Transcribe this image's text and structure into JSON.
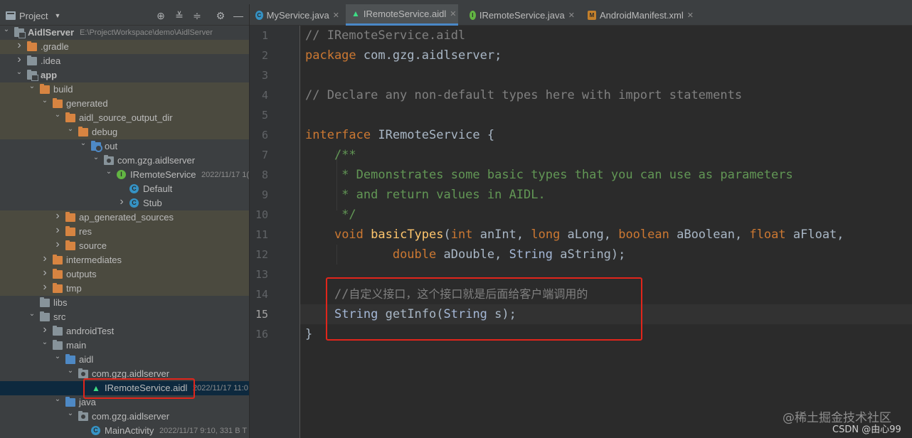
{
  "project_panel": {
    "title": "Project",
    "tree": [
      {
        "label": "AidlServer",
        "meta": "E:\\ProjectWorkspace\\demo\\AidlServer",
        "icon": "module-folder-icon",
        "arrow": "open",
        "bold": true
      },
      {
        "label": ".gradle",
        "icon": "folder-icon-orange",
        "arrow": "closed",
        "excluded": true
      },
      {
        "label": ".idea",
        "icon": "folder-icon-grey",
        "arrow": "closed"
      },
      {
        "label": "app",
        "icon": "module-folder-icon",
        "arrow": "open",
        "bold": true
      },
      {
        "label": "build",
        "icon": "folder-icon-orange",
        "arrow": "open",
        "excluded": true
      },
      {
        "label": "generated",
        "icon": "folder-icon-orange",
        "arrow": "open",
        "excluded": true
      },
      {
        "label": "aidl_source_output_dir",
        "icon": "folder-icon-orange",
        "arrow": "open",
        "excluded": true
      },
      {
        "label": "debug",
        "icon": "folder-icon-orange",
        "arrow": "open",
        "excluded": true
      },
      {
        "label": "out",
        "icon": "generated-source-folder-icon",
        "arrow": "open"
      },
      {
        "label": "com.gzg.aidlserver",
        "icon": "package-icon",
        "arrow": "open"
      },
      {
        "label": "IRemoteService",
        "meta": "2022/11/17 1(",
        "icon": "interface-icon",
        "arrow": "open"
      },
      {
        "label": "Default",
        "icon": "class-icon"
      },
      {
        "label": "Stub",
        "icon": "abstract-class-icon",
        "arrow": "closed"
      },
      {
        "label": "ap_generated_sources",
        "icon": "folder-icon-orange",
        "arrow": "closed",
        "excluded": true
      },
      {
        "label": "res",
        "icon": "folder-icon-orange",
        "arrow": "closed",
        "excluded": true
      },
      {
        "label": "source",
        "icon": "folder-icon-orange",
        "arrow": "closed",
        "excluded": true
      },
      {
        "label": "intermediates",
        "icon": "folder-icon-orange",
        "arrow": "closed",
        "excluded": true
      },
      {
        "label": "outputs",
        "icon": "folder-icon-orange",
        "arrow": "closed",
        "excluded": true
      },
      {
        "label": "tmp",
        "icon": "folder-icon-orange",
        "arrow": "closed",
        "excluded": true
      },
      {
        "label": "libs",
        "icon": "folder-icon-grey"
      },
      {
        "label": "src",
        "icon": "folder-icon-grey",
        "arrow": "open"
      },
      {
        "label": "androidTest",
        "icon": "folder-icon-grey",
        "arrow": "closed"
      },
      {
        "label": "main",
        "icon": "folder-icon-grey",
        "arrow": "open"
      },
      {
        "label": "aidl",
        "icon": "folder-icon-blue",
        "arrow": "open"
      },
      {
        "label": "com.gzg.aidlserver",
        "icon": "package-icon",
        "arrow": "open"
      },
      {
        "label": "IRemoteService.aidl",
        "meta": "2022/11/17 11:0",
        "icon": "android-file-icon",
        "selected": true
      },
      {
        "label": "java",
        "icon": "folder-icon-blue",
        "arrow": "open"
      },
      {
        "label": "com.gzg.aidlserver",
        "icon": "package-icon",
        "arrow": "open"
      },
      {
        "label": "MainActivity",
        "meta": "2022/11/17 9:10, 331 B T",
        "icon": "class-icon"
      }
    ]
  },
  "editor": {
    "tabs": [
      {
        "label": "MyService.java",
        "icon": "class-icon"
      },
      {
        "label": "IRemoteService.aidl",
        "icon": "android-file-icon",
        "active": true
      },
      {
        "label": "IRemoteService.java",
        "icon": "interface-icon"
      },
      {
        "label": "AndroidManifest.xml",
        "icon": "xml-file-icon"
      }
    ],
    "line_numbers": [
      "1",
      "2",
      "3",
      "4",
      "5",
      "6",
      "7",
      "8",
      "9",
      "10",
      "11",
      "12",
      "13",
      "14",
      "15",
      "16"
    ],
    "current_line": "15",
    "code": {
      "l1": "// IRemoteService.aidl",
      "l2_kw": "package",
      "l2_rest": " com.gzg.aidlserver;",
      "l4": "// Declare any non-default types here with import statements",
      "l6_kw": "interface",
      "l6_rest": " IRemoteService {",
      "l7": "    /**",
      "l8": "     * Demonstrates some basic types that you can use as parameters",
      "l9": "     * and return values in AIDL.",
      "l10": "     */",
      "l11_a": "    ",
      "l11_kw1": "void",
      "l11_fn": " basicTypes",
      "l11_b": "(",
      "l11_kw2": "int",
      "l11_c": " anInt, ",
      "l11_kw3": "long",
      "l11_d": " aLong, ",
      "l11_kw4": "boolean",
      "l11_e": " aBoolean, ",
      "l11_kw5": "float",
      "l11_f": " aFloat,",
      "l12_a": "            ",
      "l12_kw": "double",
      "l12_b": " aDouble, ",
      "l12_ty": "String",
      "l12_c": " aString);",
      "l14_slash": "    //",
      "l14_cjk": "自定义接口，这个接口就是后面给客户端调用的",
      "l15_a": "    ",
      "l15_ty1": "String",
      "l15_b": " getInfo(",
      "l15_ty2": "String",
      "l15_c": " s);",
      "l16": "}"
    }
  },
  "watermark": {
    "site": "@稀土掘金技术社区",
    "credit": "CSDN @由心99"
  }
}
